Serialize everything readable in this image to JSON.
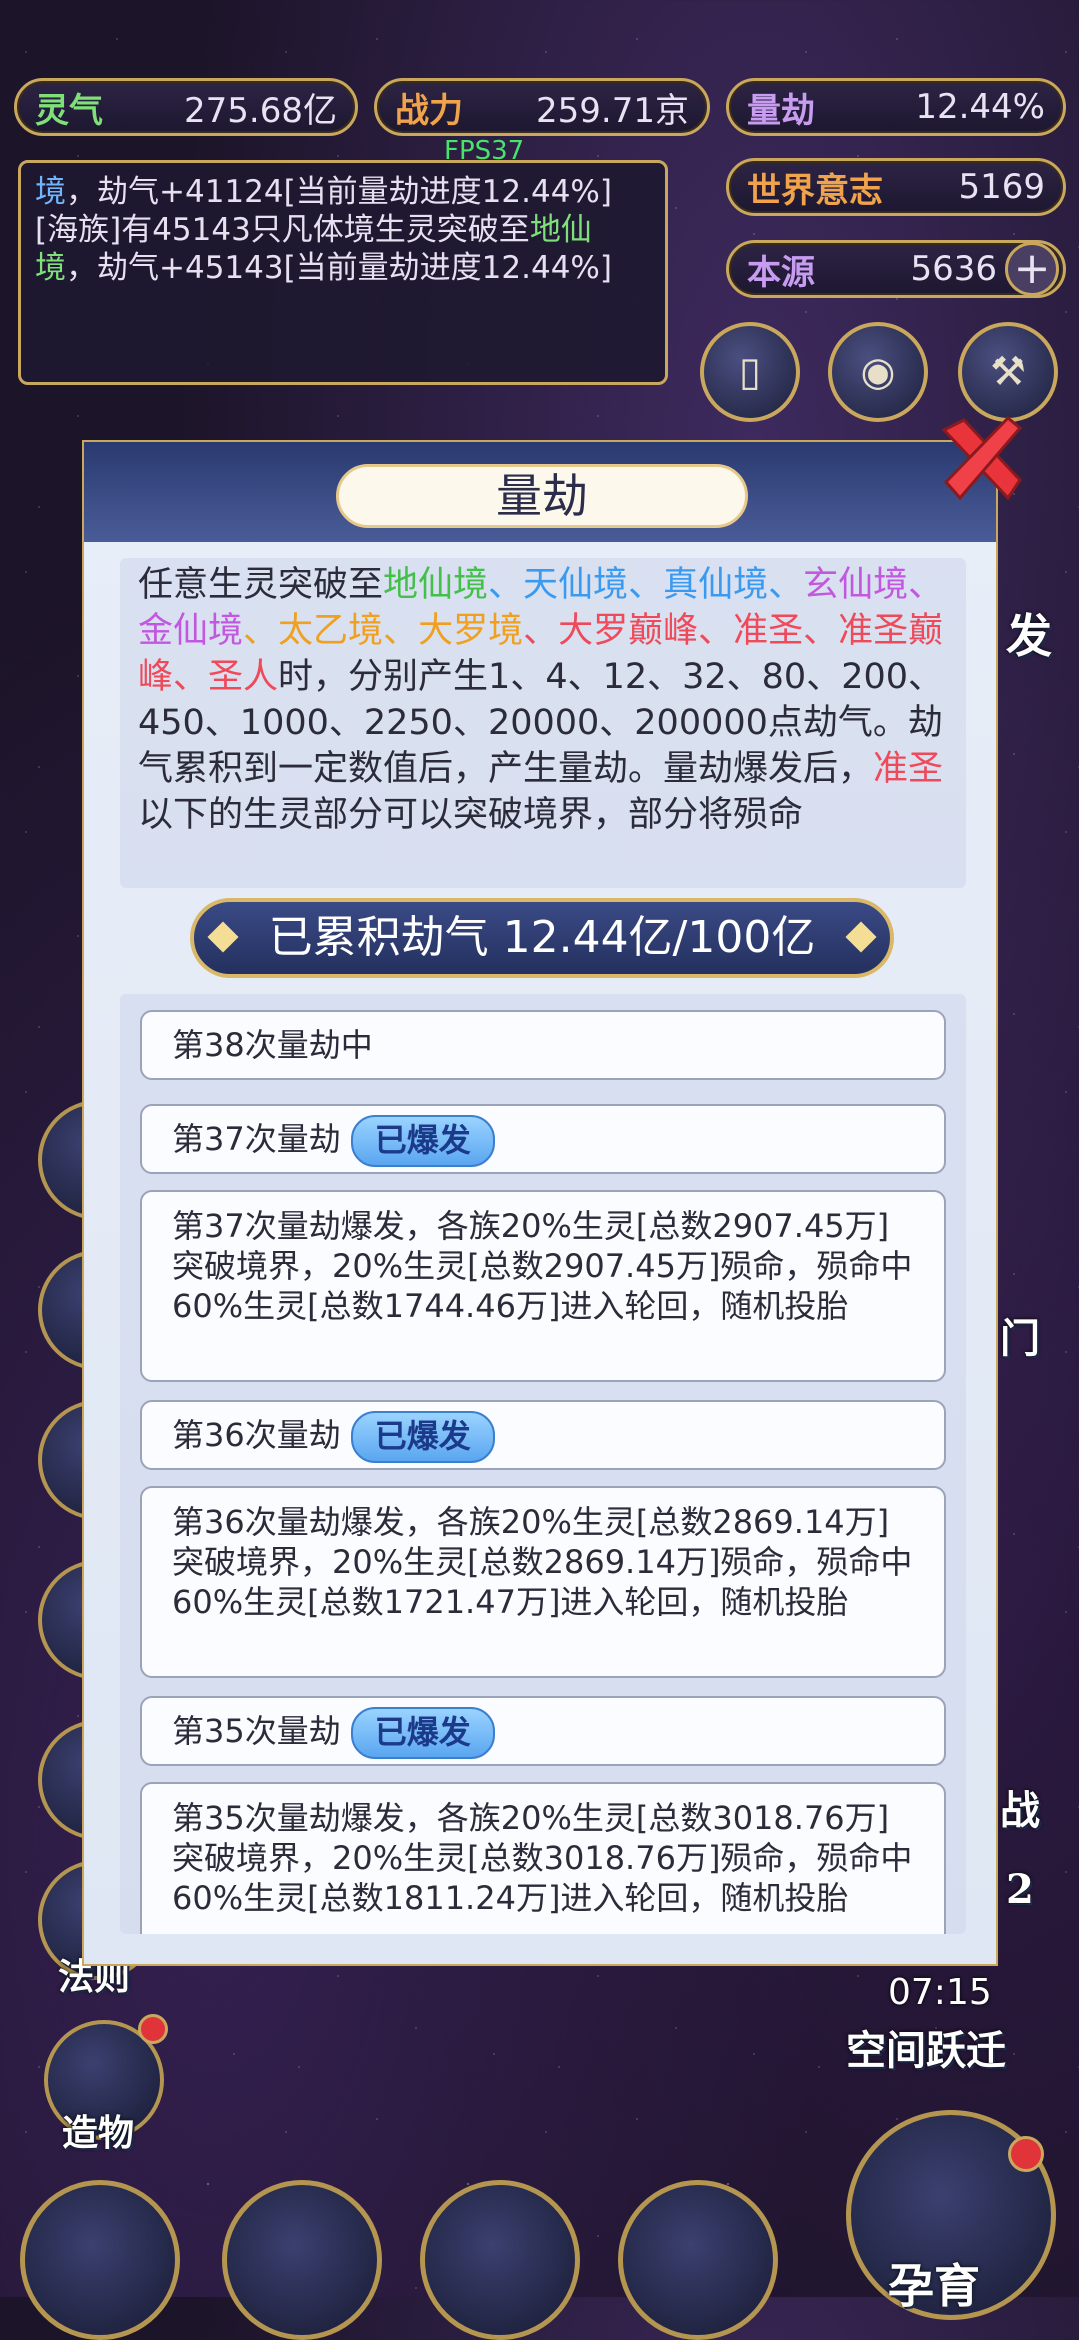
{
  "resources": {
    "lingqi": {
      "label": "灵气",
      "value": "275.68亿"
    },
    "zhanli": {
      "label": "战力",
      "value": "259.71京"
    },
    "liangjie": {
      "label": "量劫",
      "value": "12.44%"
    },
    "world_will": {
      "label": "世界意志",
      "value": "5169"
    },
    "benyuan": {
      "label": "本源",
      "value": "5636",
      "plus": "+"
    }
  },
  "fps": "FPS37",
  "log": {
    "line1_prefix": "境",
    "line1_rest": "，劫气+41124[当前量劫进度12.44%]",
    "line2_a": "[海族]有45143只凡体境生灵突破至",
    "line2_b": "地仙境",
    "line2_c": "，劫气+45143[当前量劫进度12.44%]"
  },
  "modal": {
    "title": "量劫",
    "desc": {
      "p1": "任意生灵突破至",
      "r1": "地仙境",
      "s1": "、",
      "r2": "天仙境",
      "s2": "、",
      "r3": "真仙境",
      "s3": "、",
      "r4": "玄仙境",
      "s4": "、",
      "r5": "金仙境",
      "s5": "、",
      "r6": "太乙境",
      "s6": "、",
      "r7": "大罗境",
      "s7": "、",
      "r8": "大罗巅峰",
      "s8": "、",
      "r9": "准圣",
      "s9": "、",
      "r10": "准圣巅峰",
      "s10": "、",
      "r11": "圣人",
      "p2": "时，分别产生1、4、12、32、80、200、450、1000、2250、20000、200000点劫气。劫气累积到一定数值后，产生量劫。量劫爆发后，",
      "r12": "准圣",
      "p3": "以下的生灵部分可以突破境界，部分将殒命"
    },
    "accumulated": "已累积劫气 12.44亿/100亿",
    "entries": [
      {
        "title": "第38次量劫中"
      },
      {
        "title": "第37次量劫",
        "badge": "已爆发",
        "text": "第37次量劫爆发，各族20%生灵[总数2907.45万]突破境界，20%生灵[总数2907.45万]殒命，殒命中60%生灵[总数1744.46万]进入轮回，随机投胎"
      },
      {
        "title": "第36次量劫",
        "badge": "已爆发",
        "text": "第36次量劫爆发，各族20%生灵[总数2869.14万]突破境界，20%生灵[总数2869.14万]殒命，殒命中60%生灵[总数1721.47万]进入轮回，随机投胎"
      },
      {
        "title": "第35次量劫",
        "badge": "已爆发",
        "text": "第35次量劫爆发，各族20%生灵[总数3018.76万]突破境界，20%生灵[总数3018.76万]殒命，殒命中60%生灵[总数1811.24万]进入轮回，随机投胎"
      }
    ]
  },
  "side": {
    "fa_ze": "法则",
    "zao_wu": "造物",
    "timer": "07:15",
    "space_jump": "空间跃迁",
    "badge_num": "2",
    "yun_yu": "孕育",
    "bao_fa_partial": "发",
    "men_partial": "门",
    "zhan_partial": "战"
  },
  "icons": {
    "close": "close-x-icon",
    "card": "card-icon",
    "eye": "eye-icon",
    "hammer": "hammer-icon"
  }
}
